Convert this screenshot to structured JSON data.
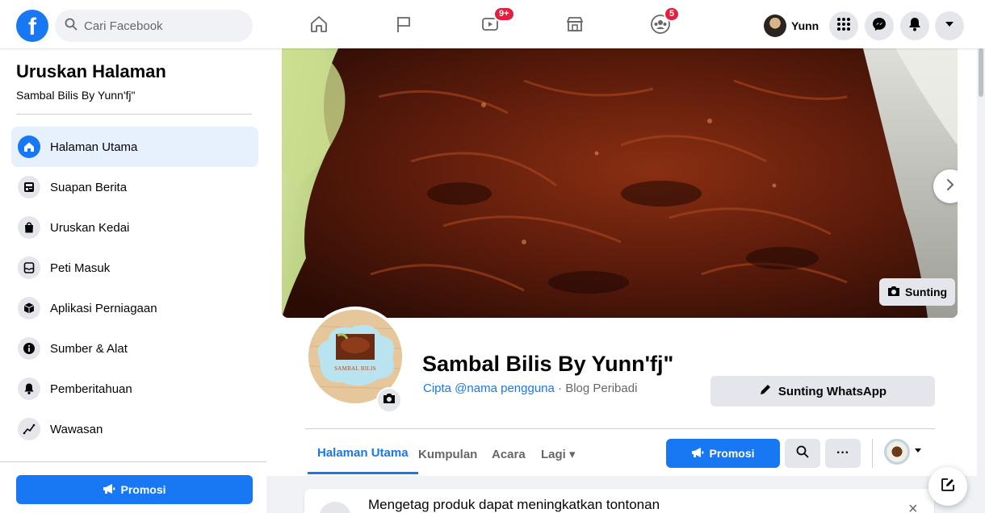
{
  "topbar": {
    "logo": "f",
    "search_placeholder": "Cari Facebook",
    "nav": [
      {
        "icon": "home-icon"
      },
      {
        "icon": "flag-icon"
      },
      {
        "icon": "watch-icon",
        "badge": "9+"
      },
      {
        "icon": "marketplace-icon"
      },
      {
        "icon": "groups-icon",
        "badge": "5"
      }
    ],
    "user_name": "Yunn"
  },
  "sidebar": {
    "title": "Uruskan Halaman",
    "page_name": "Sambal Bilis By Yunn'fj\"",
    "items": [
      {
        "label": "Halaman Utama",
        "icon": "home-icon",
        "active": true
      },
      {
        "label": "Suapan Berita",
        "icon": "news-feed-icon"
      },
      {
        "label": "Uruskan Kedai",
        "icon": "shopping-bag-icon"
      },
      {
        "label": "Peti Masuk",
        "icon": "inbox-icon"
      },
      {
        "label": "Aplikasi Perniagaan",
        "icon": "cube-icon"
      },
      {
        "label": "Sumber & Alat",
        "icon": "info-icon"
      },
      {
        "label": "Pemberitahuan",
        "icon": "bell-icon"
      },
      {
        "label": "Wawasan",
        "icon": "insights-icon"
      }
    ],
    "promo_label": "Promosi"
  },
  "cover": {
    "edit_label": "Sunting"
  },
  "profile": {
    "avatar_text": "SAMBAL BILIS",
    "name": "Sambal Bilis By Yunn'fj\"",
    "username_link": "Cipta @nama pengguna",
    "separator": " · ",
    "category": "Blog Peribadi",
    "whatsapp_label": "Sunting WhatsApp"
  },
  "tabs": [
    {
      "label": "Halaman Utama",
      "active": true
    },
    {
      "label": "Kumpulan"
    },
    {
      "label": "Acara"
    },
    {
      "label": "Lagi ▾"
    }
  ],
  "actions": {
    "promo_label": "Promosi",
    "more_label": "···"
  },
  "notice": {
    "text": "Mengetag produk dapat meningkatkan tontonan",
    "close": "×"
  },
  "colors": {
    "brand": "#1877f2",
    "badge": "#e41e3f"
  }
}
